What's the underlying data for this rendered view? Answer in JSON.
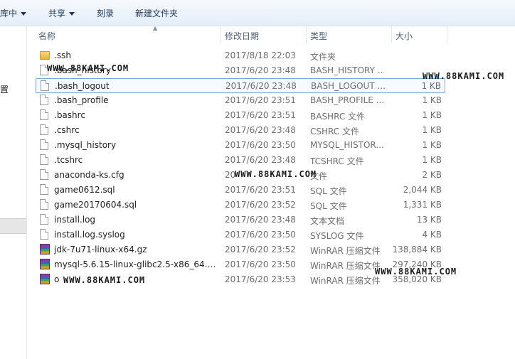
{
  "toolbar": {
    "library_label": "库中",
    "share_label": "共享",
    "burn_label": "刻录",
    "new_folder_label": "新建文件夹"
  },
  "left_pane": {
    "partial_label": "置"
  },
  "columns": {
    "name": "名称",
    "modified": "修改日期",
    "type": "类型",
    "size": "大小"
  },
  "files": [
    {
      "name": ".ssh",
      "date": "2017/8/18 22:03",
      "type": "文件夹",
      "size": "",
      "icon": "folder-icon"
    },
    {
      "name": ".bash_history",
      "date": "2017/6/20 23:48",
      "type": "BASH_HISTORY ...",
      "size": "",
      "icon": "file-icon"
    },
    {
      "name": ".bash_logout",
      "date": "2017/6/20 23:48",
      "type": "BASH_LOGOUT ...",
      "size": "1 KB",
      "icon": "file-icon"
    },
    {
      "name": ".bash_profile",
      "date": "2017/6/20 23:51",
      "type": "BASH_PROFILE ...",
      "size": "1 KB",
      "icon": "file-icon"
    },
    {
      "name": ".bashrc",
      "date": "2017/6/20 23:51",
      "type": "BASHRC 文件",
      "size": "1 KB",
      "icon": "file-icon"
    },
    {
      "name": ".cshrc",
      "date": "2017/6/20 23:48",
      "type": "CSHRC 文件",
      "size": "1 KB",
      "icon": "file-icon"
    },
    {
      "name": ".mysql_history",
      "date": "2017/6/20 23:50",
      "type": "MYSQL_HISTOR...",
      "size": "1 KB",
      "icon": "file-icon"
    },
    {
      "name": ".tcshrc",
      "date": "2017/6/20 23:48",
      "type": "TCSHRC 文件",
      "size": "1 KB",
      "icon": "file-icon"
    },
    {
      "name": "anaconda-ks.cfg",
      "date": "20",
      "type": "文件",
      "size": "2 KB",
      "icon": "file-icon"
    },
    {
      "name": "game0612.sql",
      "date": "2017/6/20 23:51",
      "type": "SQL 文件",
      "size": "2,044 KB",
      "icon": "file-icon"
    },
    {
      "name": "game20170604.sql",
      "date": "2017/6/20 23:52",
      "type": "SQL 文件",
      "size": "1,331 KB",
      "icon": "file-icon"
    },
    {
      "name": "install.log",
      "date": "2017/6/20 23:48",
      "type": "文本文档",
      "size": "13 KB",
      "icon": "file-icon"
    },
    {
      "name": "install.log.syslog",
      "date": "2017/6/20 23:50",
      "type": "SYSLOG 文件",
      "size": "4 KB",
      "icon": "file-icon"
    },
    {
      "name": "jdk-7u71-linux-x64.gz",
      "date": "2017/6/20 23:52",
      "type": "WinRAR 压缩文件",
      "size": "138,884 KB",
      "icon": "winrar-icon"
    },
    {
      "name": "mysql-5.6.15-linux-glibc2.5-x86_64.tar...",
      "date": "2017/6/20 23:50",
      "type": "WinRAR 压缩文件",
      "size": "297,240 KB",
      "icon": "winrar-icon"
    },
    {
      "name": "o",
      "date": "2017/6/20 23:53",
      "type": "WinRAR 压缩文件",
      "size": "358,020 KB",
      "icon": "winrar-icon"
    }
  ],
  "watermarks": [
    "WWW.88KAMI.COM",
    "WWW.88KAMI.COM",
    "WWW.88KAMI.COM",
    "WWW.88KAMI.COM",
    "WWW.88KAMI.COM"
  ]
}
